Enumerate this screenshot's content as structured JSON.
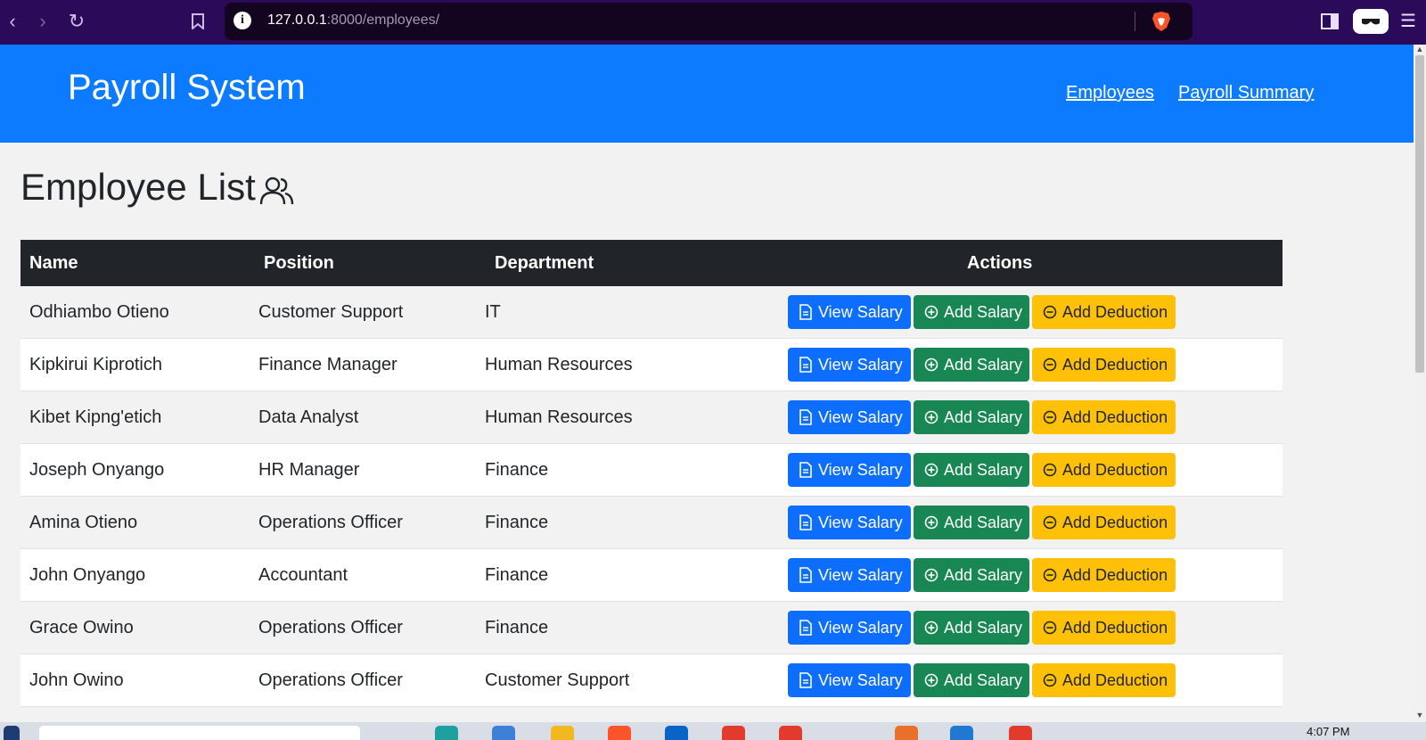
{
  "browser": {
    "url_host": "127.0.0.1",
    "url_path": ":8000/employees/"
  },
  "header": {
    "title": "Payroll System",
    "nav": [
      "Employees",
      "Payroll Summary"
    ]
  },
  "page": {
    "title": "Employee List"
  },
  "table": {
    "columns": [
      "Name",
      "Position",
      "Department",
      "Actions"
    ],
    "actions": [
      "View Salary",
      "Add Salary",
      "Add Deduction"
    ],
    "rows": [
      {
        "name": "Odhiambo Otieno",
        "position": "Customer Support",
        "department": "IT"
      },
      {
        "name": "Kipkirui Kiprotich",
        "position": "Finance Manager",
        "department": "Human Resources"
      },
      {
        "name": "Kibet Kipng'etich",
        "position": "Data Analyst",
        "department": "Human Resources"
      },
      {
        "name": "Joseph Onyango",
        "position": "HR Manager",
        "department": "Finance"
      },
      {
        "name": "Amina Otieno",
        "position": "Operations Officer",
        "department": "Finance"
      },
      {
        "name": "John Onyango",
        "position": "Accountant",
        "department": "Finance"
      },
      {
        "name": "Grace Owino",
        "position": "Operations Officer",
        "department": "Finance"
      },
      {
        "name": "John Owino",
        "position": "Operations Officer",
        "department": "Customer Support"
      }
    ]
  },
  "taskbar": {
    "clock": "4:07 PM"
  },
  "colors": {
    "header": "#0d7bff",
    "table_head": "#212529",
    "view_button": "#0d6efd",
    "add_button": "#198754",
    "deduction_button": "#ffc107"
  }
}
